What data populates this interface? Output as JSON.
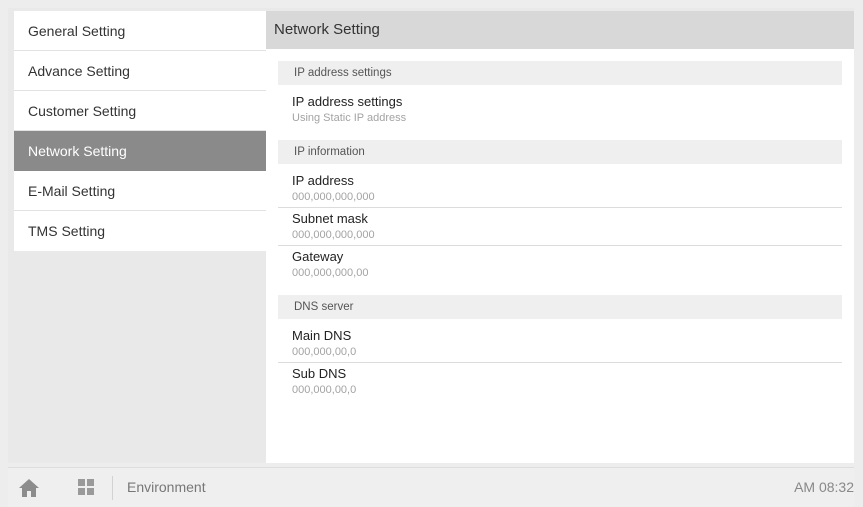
{
  "sidebar": {
    "items": [
      {
        "label": "General Setting"
      },
      {
        "label": "Advance Setting"
      },
      {
        "label": "Customer Setting"
      },
      {
        "label": "Network Setting"
      },
      {
        "label": "E-Mail Setting"
      },
      {
        "label": "TMS Setting"
      }
    ],
    "active": "Network Setting"
  },
  "main": {
    "title": "Network Setting",
    "sections": [
      {
        "header": "IP address settings",
        "rows": [
          {
            "title": "IP address settings",
            "value": "Using Static IP address"
          }
        ]
      },
      {
        "header": "IP information",
        "rows": [
          {
            "title": "IP address",
            "value": "000,000,000,000"
          },
          {
            "title": "Subnet mask",
            "value": "000,000,000,000"
          },
          {
            "title": "Gateway",
            "value": "000,000,000,00"
          }
        ]
      },
      {
        "header": "DNS server",
        "rows": [
          {
            "title": "Main DNS",
            "value": "000,000,00,0"
          },
          {
            "title": "Sub DNS",
            "value": "000,000,00,0"
          }
        ]
      }
    ]
  },
  "bottombar": {
    "home_icon": "home-icon",
    "apps_icon": "grid-icon",
    "breadcrumb": "Environment",
    "clock": "AM 08:32"
  },
  "colors": {
    "active_item_bg": "#8a8a8a",
    "header_bg": "#d8d8d8",
    "section_bg": "#efefef",
    "icon": "#8c8c8c"
  }
}
